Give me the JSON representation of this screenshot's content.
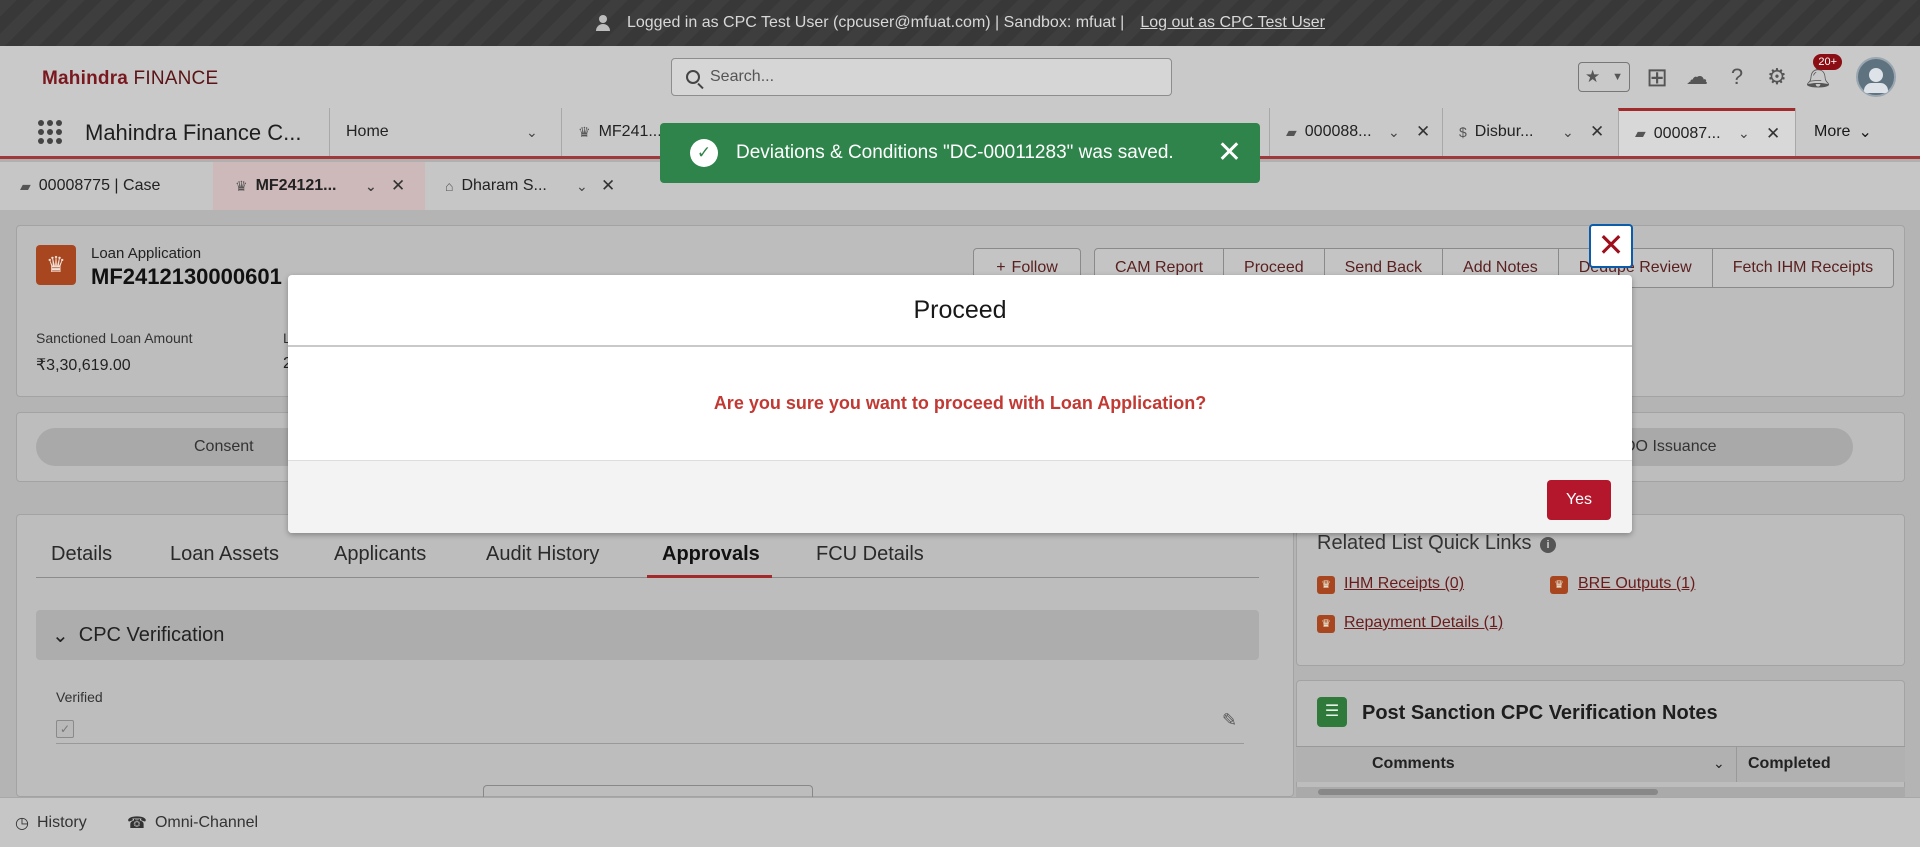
{
  "login_bar": {
    "message": "Logged in as CPC Test User (cpcuser@mfuat.com) | Sandbox: mfuat |",
    "logout_link": "Log out as CPC Test User"
  },
  "header": {
    "brand_bold": "Mahindra",
    "brand_rest": "FINANCE",
    "search_placeholder": "Search...",
    "notification_count": "20+"
  },
  "nav": {
    "app_name": "Mahindra Finance C...",
    "tabs": [
      {
        "label": "Home"
      },
      {
        "label": "MF241..."
      },
      {
        "label": "000088..."
      },
      {
        "label": "Disbur..."
      },
      {
        "label": "000087..."
      }
    ],
    "more_label": "More"
  },
  "subtabs": [
    {
      "label": "00008775 | Case"
    },
    {
      "label": "MF24121..."
    },
    {
      "label": "Dharam S..."
    }
  ],
  "record": {
    "type": "Loan Application",
    "title": "MF2412130000601",
    "actions": {
      "follow": "Follow",
      "buttons": [
        "CAM Report",
        "Proceed",
        "Send Back",
        "Add Notes",
        "Dedupe Review",
        "Fetch IHM Receipts"
      ]
    },
    "highlights": {
      "sanctioned_label": "Sanctioned Loan Amount",
      "sanctioned_value": "₹3,30,619.00",
      "second_label": "L",
      "second_value": "2"
    }
  },
  "path": {
    "first_stage": "Consent",
    "last_stage": "DO Issuance"
  },
  "detail_tabs": [
    "Details",
    "Loan Assets",
    "Applicants",
    "Audit History",
    "Approvals",
    "FCU Details"
  ],
  "cpc_section": {
    "title": "CPC Verification",
    "field_label": "Verified"
  },
  "quick_links": {
    "title": "Related List Quick Links",
    "links": [
      "IHM Receipts (0)",
      "BRE Outputs (1)",
      "Repayment Details (1)"
    ]
  },
  "notes": {
    "title": "Post Sanction CPC Verification Notes",
    "columns": [
      "Comments",
      "Completed"
    ]
  },
  "utility": {
    "history": "History",
    "omni": "Omni-Channel"
  },
  "toast": {
    "message": "Deviations & Conditions \"DC-00011283\" was saved."
  },
  "modal": {
    "title": "Proceed",
    "message": "Are you sure you want to proceed with Loan Application?",
    "yes_label": "Yes"
  },
  "colors": {
    "toast_bg": "#2e844a",
    "brand_button": "#b4172c",
    "warning_text": "#c23934"
  }
}
